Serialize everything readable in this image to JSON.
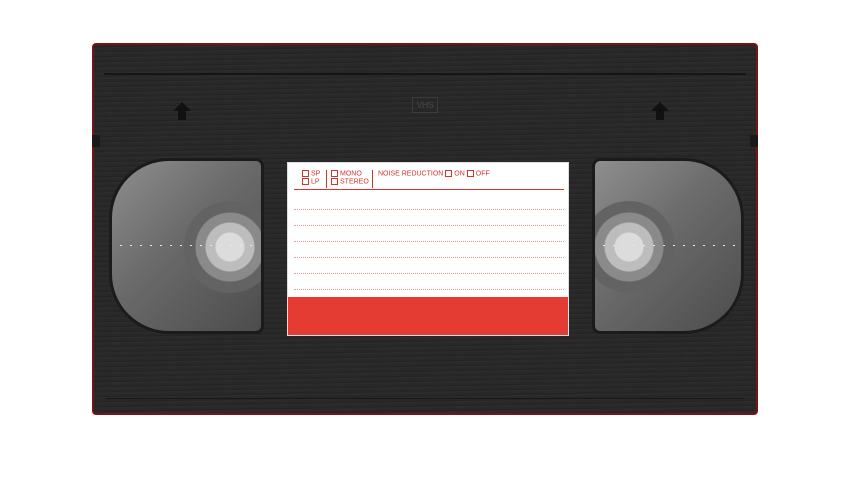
{
  "cassette": {
    "logo_text": "VHS",
    "colors": {
      "shell": "#262626",
      "edge": "#7a1414",
      "label_red": "#e43b33",
      "label_print": "#d4342c"
    }
  },
  "label": {
    "speed": {
      "sp": "SP",
      "lp": "LP"
    },
    "audio": {
      "mono": "MONO",
      "stereo": "STEREO"
    },
    "noise_reduction": {
      "title": "NOISE REDUCTION",
      "on": "ON",
      "off": "OFF"
    }
  },
  "icons": [
    "up-arrow-icon",
    "up-arrow-icon"
  ]
}
